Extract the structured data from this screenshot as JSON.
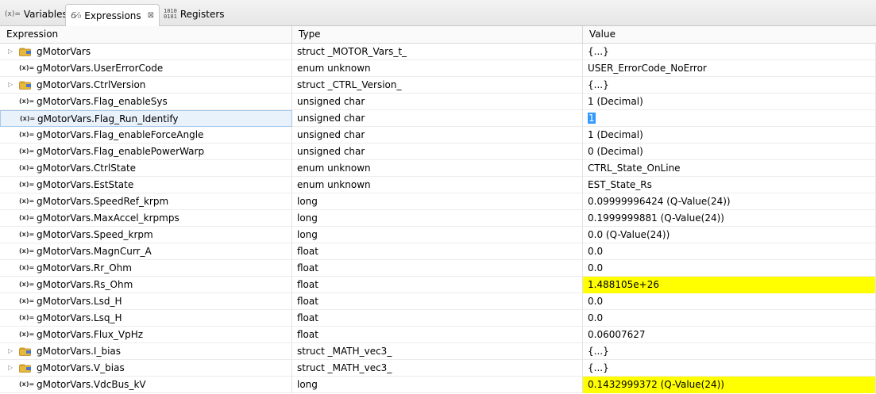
{
  "tabs": [
    {
      "icon": "(x)=",
      "label": "Variables"
    },
    {
      "icon": "6⁄₀",
      "label": "Expressions",
      "close": "⊠"
    },
    {
      "icon": "1010\n0101",
      "label": "Registers"
    }
  ],
  "columns": [
    "Expression",
    "Type",
    "Value"
  ],
  "colors": {
    "highlight": "#ffff00",
    "selection": "#3399ff",
    "struct_icon": "#e8b83c"
  },
  "rows": [
    {
      "name": "gMotorVars",
      "type": "struct _MOTOR_Vars_t_",
      "value": "{...}",
      "icon": "struct",
      "expand": "▷"
    },
    {
      "name": "gMotorVars.UserErrorCode",
      "type": "enum unknown",
      "value": "USER_ErrorCode_NoError",
      "icon": "var"
    },
    {
      "name": "gMotorVars.CtrlVersion",
      "type": "struct _CTRL_Version_",
      "value": "{...}",
      "icon": "struct",
      "expand": "▷"
    },
    {
      "name": "gMotorVars.Flag_enableSys",
      "type": "unsigned char",
      "value": "1 (Decimal)",
      "icon": "var"
    },
    {
      "name": "gMotorVars.Flag_Run_Identify",
      "type": "unsigned char",
      "value": "1",
      "icon": "var",
      "selected": true
    },
    {
      "name": "gMotorVars.Flag_enableForceAngle",
      "type": "unsigned char",
      "value": "1 (Decimal)",
      "icon": "var"
    },
    {
      "name": "gMotorVars.Flag_enablePowerWarp",
      "type": "unsigned char",
      "value": "0 (Decimal)",
      "icon": "var"
    },
    {
      "name": "gMotorVars.CtrlState",
      "type": "enum unknown",
      "value": "CTRL_State_OnLine",
      "icon": "var"
    },
    {
      "name": "gMotorVars.EstState",
      "type": "enum unknown",
      "value": "EST_State_Rs",
      "icon": "var"
    },
    {
      "name": "gMotorVars.SpeedRef_krpm",
      "type": "long",
      "value": "0.09999996424 (Q-Value(24))",
      "icon": "var"
    },
    {
      "name": "gMotorVars.MaxAccel_krpmps",
      "type": "long",
      "value": "0.1999999881 (Q-Value(24))",
      "icon": "var"
    },
    {
      "name": "gMotorVars.Speed_krpm",
      "type": "long",
      "value": "0.0 (Q-Value(24))",
      "icon": "var"
    },
    {
      "name": "gMotorVars.MagnCurr_A",
      "type": "float",
      "value": "0.0",
      "icon": "var"
    },
    {
      "name": "gMotorVars.Rr_Ohm",
      "type": "float",
      "value": "0.0",
      "icon": "var"
    },
    {
      "name": "gMotorVars.Rs_Ohm",
      "type": "float",
      "value": "1.488105e+26",
      "icon": "var",
      "highlight": true
    },
    {
      "name": "gMotorVars.Lsd_H",
      "type": "float",
      "value": "0.0",
      "icon": "var"
    },
    {
      "name": "gMotorVars.Lsq_H",
      "type": "float",
      "value": "0.0",
      "icon": "var"
    },
    {
      "name": "gMotorVars.Flux_VpHz",
      "type": "float",
      "value": "0.06007627",
      "icon": "var"
    },
    {
      "name": "gMotorVars.I_bias",
      "type": "struct _MATH_vec3_",
      "value": "{...}",
      "icon": "struct",
      "expand": "▷"
    },
    {
      "name": "gMotorVars.V_bias",
      "type": "struct _MATH_vec3_",
      "value": "{...}",
      "icon": "struct",
      "expand": "▷"
    },
    {
      "name": "gMotorVars.VdcBus_kV",
      "type": "long",
      "value": "0.1432999372 (Q-Value(24))",
      "icon": "var",
      "highlight": true
    }
  ]
}
